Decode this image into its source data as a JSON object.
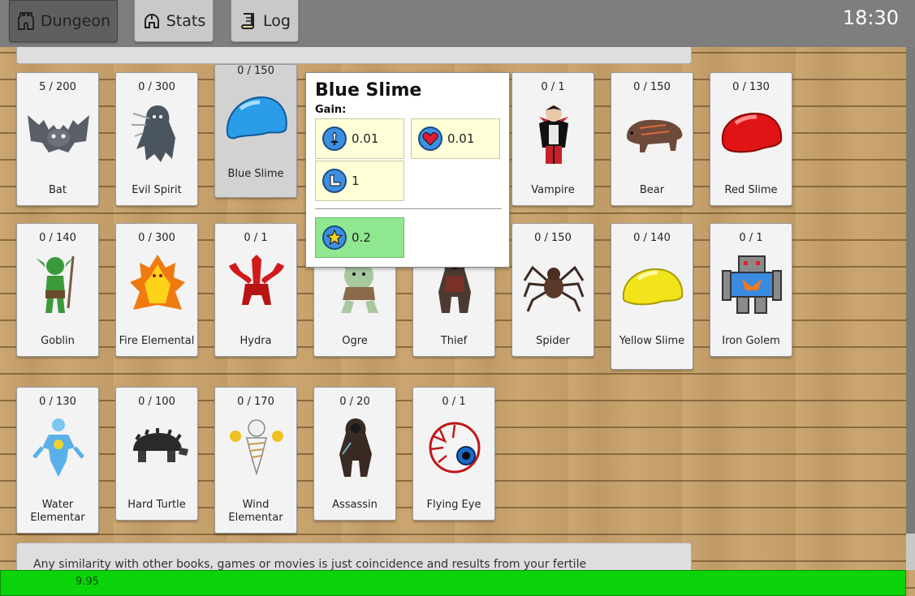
{
  "tabs": [
    {
      "label": "Dungeon",
      "active": true,
      "icon": "castle-icon"
    },
    {
      "label": "Stats",
      "active": false,
      "icon": "helmet-icon"
    },
    {
      "label": "Log",
      "active": false,
      "icon": "scroll-icon"
    }
  ],
  "clock": "18:30",
  "monsters": [
    {
      "name": "Bat",
      "count": "5 / 200",
      "icon": "bat-icon"
    },
    {
      "name": "Evil Spirit",
      "count": "0 / 300",
      "icon": "evil-spirit-icon"
    },
    {
      "name": "Blue Slime",
      "count": "0 / 150",
      "icon": "blue-slime-icon"
    },
    {
      "name": "Vampire",
      "count": "0 / 1",
      "icon": "vampire-icon"
    },
    {
      "name": "Bear",
      "count": "0 / 150",
      "icon": "bear-icon"
    },
    {
      "name": "Red Slime",
      "count": "0 / 130",
      "icon": "red-slime-icon"
    },
    {
      "name": "Goblin",
      "count": "0 / 140",
      "icon": "goblin-icon"
    },
    {
      "name": "Fire Elemental",
      "count": "0 / 300",
      "icon": "fire-elemental-icon"
    },
    {
      "name": "Hydra",
      "count": "0 / 1",
      "icon": "hydra-icon"
    },
    {
      "name": "Ogre",
      "count": "",
      "icon": "ogre-icon"
    },
    {
      "name": "Thief",
      "count": "",
      "icon": "thief-icon"
    },
    {
      "name": "Spider",
      "count": "0 / 150",
      "icon": "spider-icon"
    },
    {
      "name": "Yellow Slime",
      "count": "0 / 140",
      "icon": "yellow-slime-icon"
    },
    {
      "name": "Iron Golem",
      "count": "0 / 1",
      "icon": "iron-golem-icon"
    },
    {
      "name": "Water Elementar",
      "count": "0 / 130",
      "icon": "water-elementar-icon"
    },
    {
      "name": "Hard Turtle",
      "count": "0 / 100",
      "icon": "hard-turtle-icon"
    },
    {
      "name": "Wind Elementar",
      "count": "0 / 170",
      "icon": "wind-elementar-icon"
    },
    {
      "name": "Assassin",
      "count": "0 / 20",
      "icon": "assassin-icon"
    },
    {
      "name": "Flying Eye",
      "count": "0 / 1",
      "icon": "flying-eye-icon"
    }
  ],
  "tooltip": {
    "title": "Blue Slime",
    "gain_label": "Gain:",
    "attack": "0.01",
    "health": "0.01",
    "speed": "1",
    "xp": "0.2"
  },
  "footer_text": "Any similarity with other books, games or movies is just coincidence and results from your fertile",
  "progress_value": "9.95",
  "colors": {
    "topbar": "#7e7e7e",
    "progress": "#0bd40b",
    "tooltip_stat": "#ffffd8",
    "tooltip_xp": "#8fe88f"
  }
}
